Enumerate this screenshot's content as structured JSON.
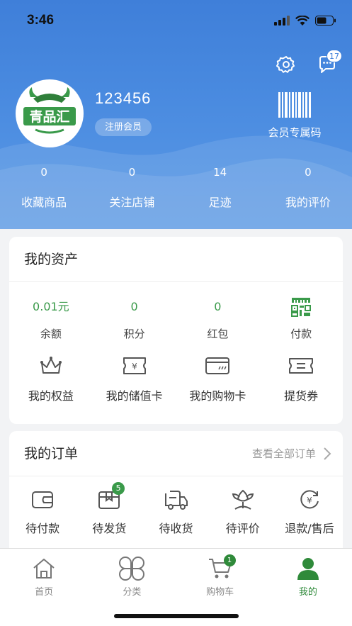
{
  "status_bar": {
    "time": "3:46"
  },
  "header": {
    "username": "123456",
    "member_tag": "注册会员",
    "barcode_label": "会员专属码",
    "message_count": "17",
    "logo_text": "青品汇",
    "stats": [
      {
        "value": "0",
        "label": "收藏商品"
      },
      {
        "value": "0",
        "label": "关注店铺"
      },
      {
        "value": "14",
        "label": "足迹"
      },
      {
        "value": "0",
        "label": "我的评价"
      }
    ]
  },
  "assets": {
    "title": "我的资产",
    "values": [
      {
        "value": "0.01元",
        "label": "余额"
      },
      {
        "value": "0",
        "label": "积分"
      },
      {
        "value": "0",
        "label": "红包"
      },
      {
        "label": "付款",
        "icon": "qr-code-icon"
      }
    ],
    "items": [
      {
        "label": "我的权益",
        "icon": "crown-icon"
      },
      {
        "label": "我的储值卡",
        "icon": "yuan-ticket-icon"
      },
      {
        "label": "我的购物卡",
        "icon": "card-icon"
      },
      {
        "label": "提货券",
        "icon": "coupon-icon"
      }
    ]
  },
  "orders": {
    "title": "我的订单",
    "view_all": "查看全部订单",
    "items": [
      {
        "label": "待付款",
        "icon": "wallet-icon"
      },
      {
        "label": "待发货",
        "icon": "box-icon",
        "badge": "5"
      },
      {
        "label": "待收货",
        "icon": "truck-icon"
      },
      {
        "label": "待评价",
        "icon": "flower-icon"
      },
      {
        "label": "退款/售后",
        "icon": "refund-icon"
      }
    ]
  },
  "tabbar": {
    "items": [
      {
        "label": "首页",
        "icon": "home-icon"
      },
      {
        "label": "分类",
        "icon": "category-icon"
      },
      {
        "label": "购物车",
        "icon": "cart-icon",
        "badge": "1"
      },
      {
        "label": "我的",
        "icon": "profile-icon"
      }
    ],
    "active": "我的"
  },
  "colors": {
    "header_blue": "#4a8be0",
    "accent_green": "#3a9a4a",
    "tab_active_green": "#2f8a3a"
  }
}
